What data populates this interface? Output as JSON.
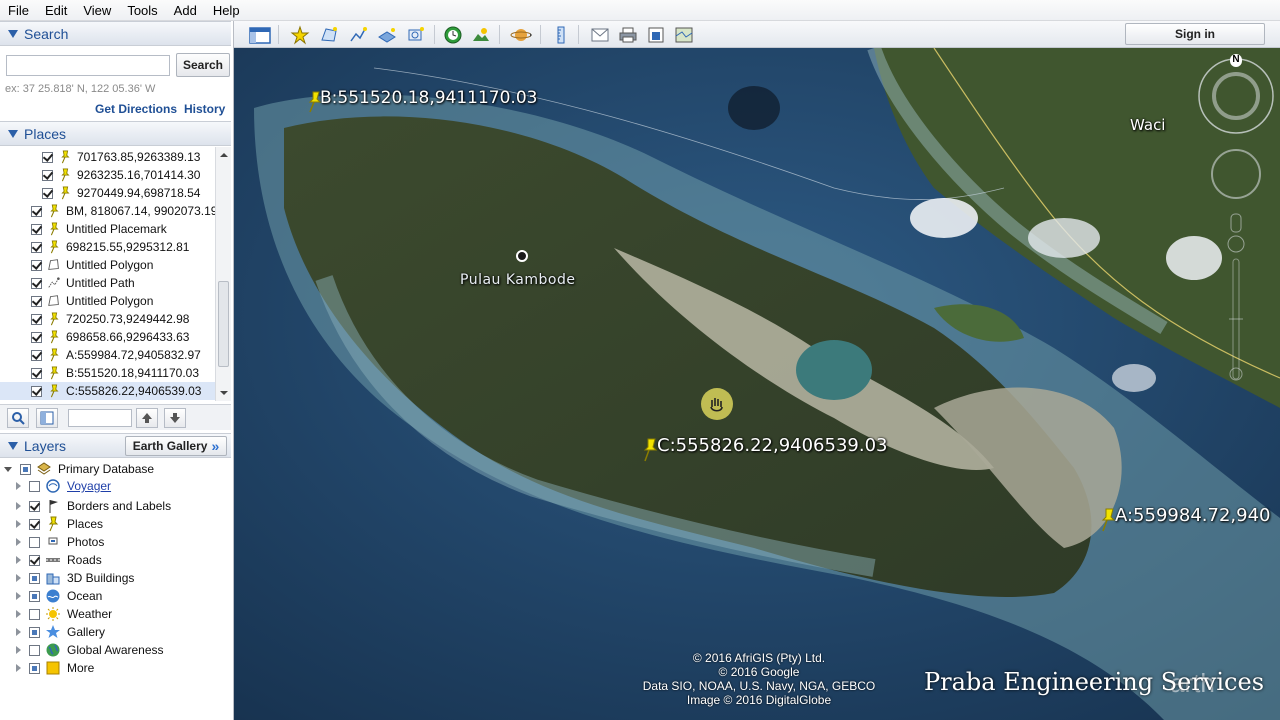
{
  "menu": [
    "File",
    "Edit",
    "View",
    "Tools",
    "Add",
    "Help"
  ],
  "search": {
    "title": "Search",
    "button": "Search",
    "hint": "ex: 37 25.818' N, 122 05.36' W",
    "get_directions": "Get Directions",
    "history": "History"
  },
  "places": {
    "title": "Places",
    "items": [
      {
        "label": "701763.85,9263389.13",
        "icon": "pushpin-icon",
        "checked": true,
        "indent": 2
      },
      {
        "label": "9263235.16,701414.30",
        "icon": "pushpin-icon",
        "checked": true,
        "indent": 2
      },
      {
        "label": "9270449.94,698718.54",
        "icon": "pushpin-icon",
        "checked": true,
        "indent": 2
      },
      {
        "label": "BM, 818067.14, 9902073.19",
        "icon": "pushpin-icon",
        "checked": true,
        "indent": 1
      },
      {
        "label": "Untitled Placemark",
        "icon": "pushpin-icon",
        "checked": true,
        "indent": 1
      },
      {
        "label": "698215.55,9295312.81",
        "icon": "pushpin-icon",
        "checked": true,
        "indent": 1
      },
      {
        "label": "Untitled Polygon",
        "icon": "polygon-icon",
        "checked": true,
        "indent": 1
      },
      {
        "label": "Untitled Path",
        "icon": "path-icon",
        "checked": true,
        "indent": 1
      },
      {
        "label": "Untitled Polygon",
        "icon": "polygon-icon",
        "checked": true,
        "indent": 1
      },
      {
        "label": "720250.73,9249442.98",
        "icon": "pushpin-icon",
        "checked": true,
        "indent": 1
      },
      {
        "label": "698658.66,9296433.63",
        "icon": "pushpin-icon",
        "checked": true,
        "indent": 1
      },
      {
        "label": "A:559984.72,9405832.97",
        "icon": "pushpin-icon",
        "checked": true,
        "indent": 1
      },
      {
        "label": "B:551520.18,9411170.03",
        "icon": "pushpin-icon",
        "checked": true,
        "indent": 1
      },
      {
        "label": "C:555826.22,9406539.03",
        "icon": "pushpin-icon",
        "checked": true,
        "indent": 1,
        "selected": true
      }
    ]
  },
  "layers": {
    "title": "Layers",
    "gallery_button": "Earth Gallery",
    "gallery_chevron": "»",
    "items": [
      {
        "label": "Primary Database",
        "icon": "database-icon",
        "state": "partial",
        "expanded": true,
        "root": true
      },
      {
        "label": "Voyager",
        "icon": "voyager-icon",
        "state": "off",
        "link": true
      },
      {
        "label": "Borders and Labels",
        "icon": "borders-icon",
        "state": "on"
      },
      {
        "label": "Places",
        "icon": "places-icon",
        "state": "on"
      },
      {
        "label": "Photos",
        "icon": "photos-icon",
        "state": "off"
      },
      {
        "label": "Roads",
        "icon": "roads-icon",
        "state": "on"
      },
      {
        "label": "3D Buildings",
        "icon": "buildings-icon",
        "state": "partial"
      },
      {
        "label": "Ocean",
        "icon": "ocean-icon",
        "state": "partial"
      },
      {
        "label": "Weather",
        "icon": "weather-icon",
        "state": "off"
      },
      {
        "label": "Gallery",
        "icon": "gallery-icon",
        "state": "partial"
      },
      {
        "label": "Global Awareness",
        "icon": "globe-icon",
        "state": "off"
      },
      {
        "label": "More",
        "icon": "more-icon",
        "state": "partial"
      }
    ]
  },
  "toolbar": {
    "sign_in": "Sign in"
  },
  "map": {
    "labels": {
      "island": "Pulau Kambode",
      "town": "Waci"
    },
    "placemarks": [
      {
        "label": "B:551520.18,9411170.03"
      },
      {
        "label": "C:555826.22,9406539.03"
      },
      {
        "label": "A:559984.72,940"
      }
    ],
    "compass_north": "N",
    "copyright": [
      "© 2016 AfriGIS (Pty) Ltd.",
      "© 2016 Google",
      "Data SIO, NOAA, U.S. Navy, NGA, GEBCO",
      "Image © 2016 DigitalGlobe"
    ],
    "watermark": "Praba Engineering Services",
    "logo_fragment": "arth"
  },
  "colors": {
    "accent": "#1f4f95",
    "ocean": "#1a3a5c",
    "pin": "#f2e200"
  }
}
